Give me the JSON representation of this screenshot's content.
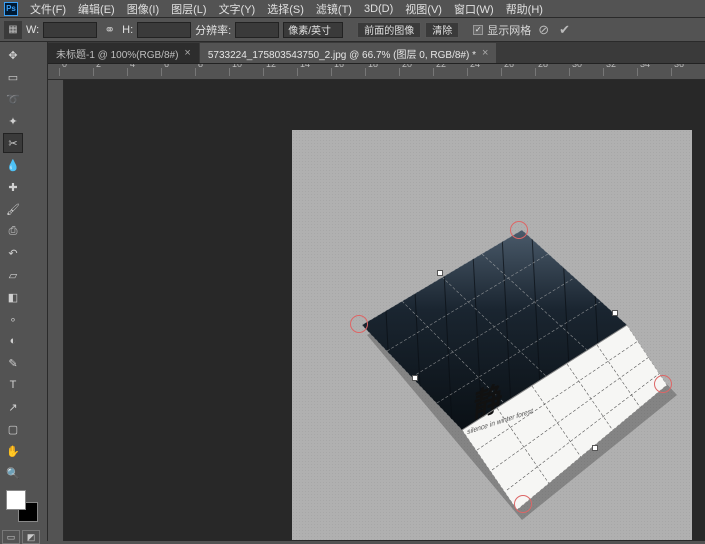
{
  "menu": {
    "items": [
      "文件(F)",
      "编辑(E)",
      "图像(I)",
      "图层(L)",
      "文字(Y)",
      "选择(S)",
      "滤镜(T)",
      "3D(D)",
      "视图(V)",
      "窗口(W)",
      "帮助(H)"
    ]
  },
  "options": {
    "w_label": "W:",
    "w_value": "",
    "link_icon": "⚭",
    "h_label": "H:",
    "h_value": "",
    "res_label": "分辨率:",
    "res_value": "",
    "unit": "像素/英寸",
    "front_image": "前面的图像",
    "clear": "清除",
    "grid_checked": true,
    "grid_label": "显示网格",
    "cancel_icon": "⊘",
    "confirm_icon": "✔"
  },
  "tabs": [
    {
      "label": "未标题-1 @ 100%(RGB/8#)",
      "active": false
    },
    {
      "label": "5733224_175803543750_2.jpg @ 66.7% (图层 0, RGB/8#) *",
      "active": true
    }
  ],
  "tools": {
    "row": [
      "move",
      "artboard",
      "lasso",
      "wand",
      "crop",
      "eyedrop",
      "heal",
      "brush",
      "stamp",
      "history",
      "eraser",
      "gradient",
      "blur",
      "dodge",
      "pen",
      "type",
      "path",
      "rect",
      "hand",
      "zoom"
    ],
    "glyphs": {
      "move": "✥",
      "artboard": "▭",
      "lasso": "➰",
      "wand": "✦",
      "crop": "✂",
      "eyedrop": "💧",
      "heal": "✚",
      "brush": "🖌",
      "stamp": "⎙",
      "history": "↶",
      "eraser": "▱",
      "gradient": "◧",
      "blur": "∘",
      "dodge": "◐",
      "pen": "✎",
      "type": "T",
      "path": "↗",
      "rect": "▢",
      "hand": "✋",
      "zoom": "🔍"
    },
    "active": "crop"
  },
  "ruler": {
    "ticks": [
      "0",
      "2",
      "4",
      "6",
      "8",
      "10",
      "12",
      "14",
      "16",
      "18",
      "20",
      "22",
      "24",
      "26",
      "28",
      "30",
      "32",
      "34",
      "36"
    ]
  },
  "mock": {
    "title_glyph": "静",
    "subtitle": "silence in winter forest"
  }
}
